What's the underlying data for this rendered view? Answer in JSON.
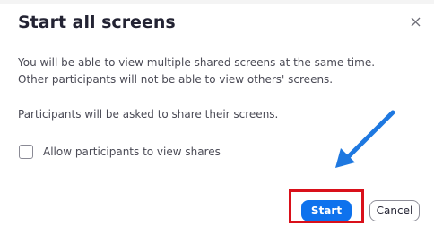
{
  "dialog": {
    "title": "Start all screens",
    "close_icon": "close-icon",
    "message_line_1": "You will be able to view multiple shared screens at the same time.",
    "message_line_2": "Other participants will not be able to view others' screens.",
    "message_line_3": "Participants will be asked to share their screens.",
    "checkbox_label": "Allow participants to view shares",
    "checkbox_checked": false,
    "start_label": "Start",
    "cancel_label": "Cancel"
  },
  "annotations": {
    "arrow_icon": "arrow-icon",
    "arrow_color": "#1e78e0",
    "highlight_color": "#d9101a"
  },
  "colors": {
    "primary_button": "#0e72ed",
    "text": "#232333",
    "muted_text": "#4a4a55"
  }
}
